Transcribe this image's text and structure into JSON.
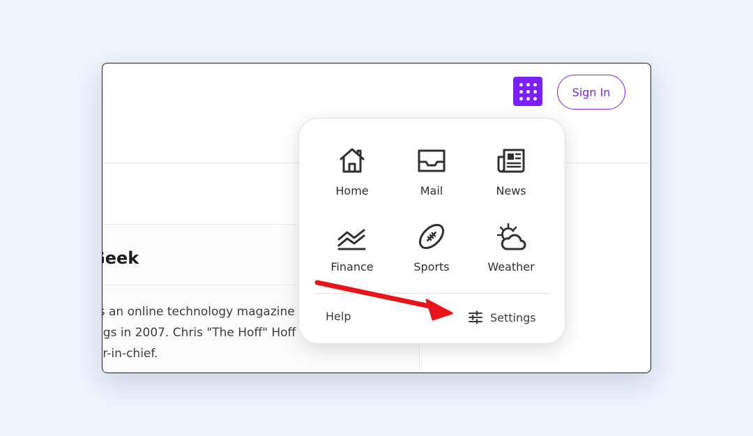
{
  "header": {
    "apps_button_label": "Apps",
    "signin_label": "Sign In"
  },
  "article": {
    "title": "Geek",
    "body_lines": [
      "is an online technology magazine",
      "ngs in 2007. Chris \"The Hoff\" Hoff",
      "or-in-chief."
    ]
  },
  "apps_menu": {
    "items": [
      {
        "label": "Home",
        "icon": "home-icon"
      },
      {
        "label": "Mail",
        "icon": "inbox-icon"
      },
      {
        "label": "News",
        "icon": "newspaper-icon"
      },
      {
        "label": "Finance",
        "icon": "chart-line-icon"
      },
      {
        "label": "Sports",
        "icon": "football-icon"
      },
      {
        "label": "Weather",
        "icon": "partly-cloudy-icon"
      }
    ],
    "help_label": "Help",
    "settings_label": "Settings",
    "settings_icon": "sliders-icon"
  },
  "colors": {
    "accent": "#7c1fff",
    "arrow": "#e8141a",
    "background": "#eff4fd"
  }
}
